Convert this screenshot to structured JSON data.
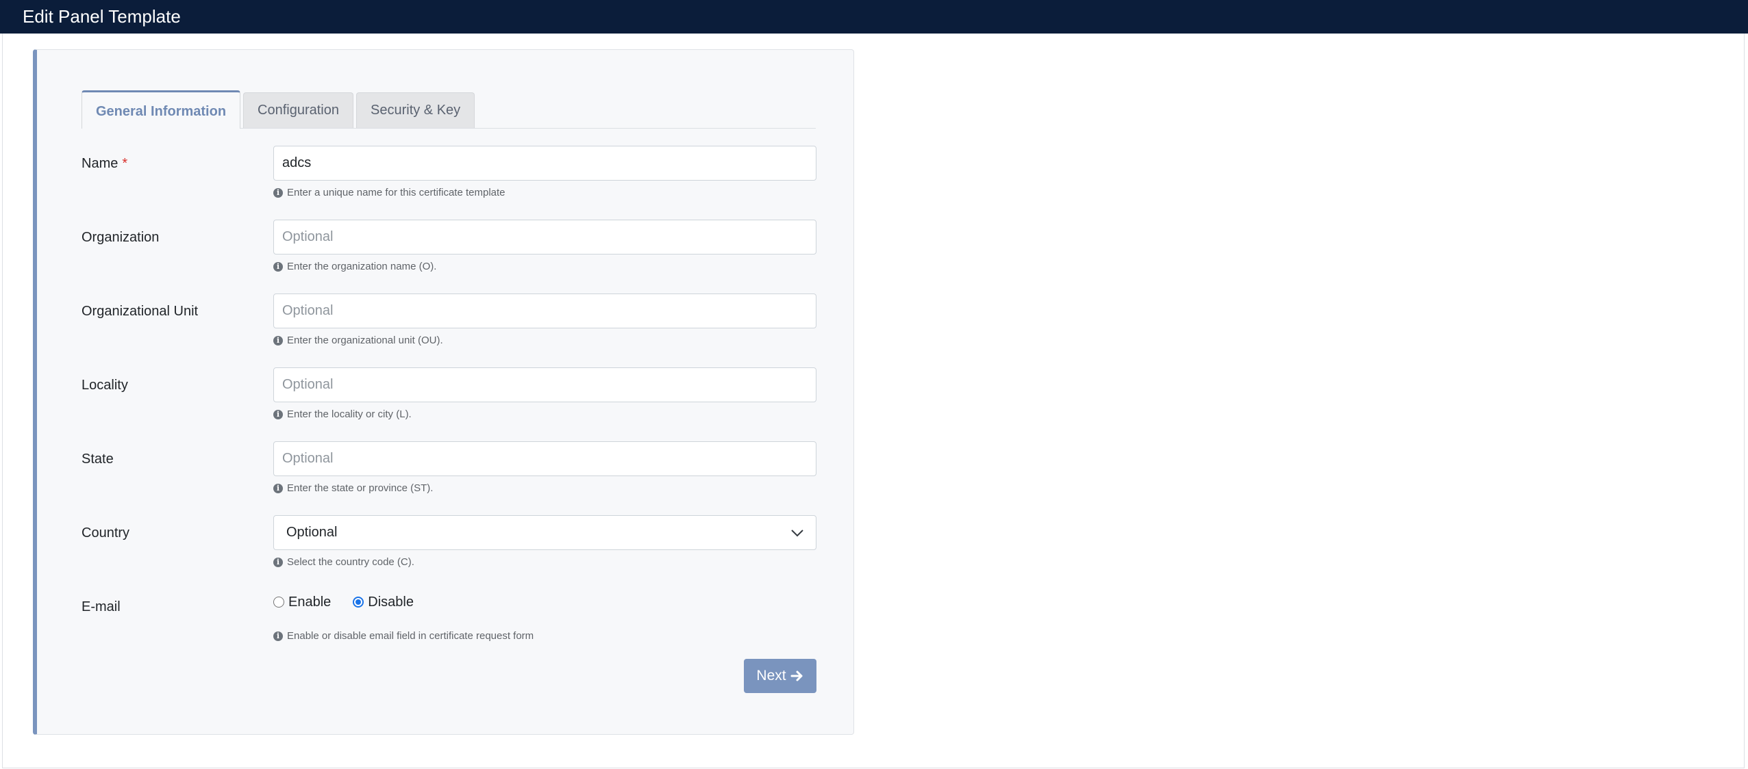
{
  "window": {
    "title": "Edit Panel Template"
  },
  "tabs": [
    {
      "label": "General Information",
      "active": true
    },
    {
      "label": "Configuration",
      "active": false
    },
    {
      "label": "Security & Key",
      "active": false
    }
  ],
  "form": {
    "name": {
      "label": "Name",
      "required_mark": "*",
      "value": "adcs",
      "help": "Enter a unique name for this certificate template"
    },
    "organization": {
      "label": "Organization",
      "placeholder": "Optional",
      "help": "Enter the organization name (O)."
    },
    "org_unit": {
      "label": "Organizational Unit",
      "placeholder": "Optional",
      "help": "Enter the organizational unit (OU)."
    },
    "locality": {
      "label": "Locality",
      "placeholder": "Optional",
      "help": "Enter the locality or city (L)."
    },
    "state": {
      "label": "State",
      "placeholder": "Optional",
      "help": "Enter the state or province (ST)."
    },
    "country": {
      "label": "Country",
      "selected": "Optional",
      "help": "Select the country code (C)."
    },
    "email": {
      "label": "E-mail",
      "options": [
        {
          "label": "Enable",
          "checked": false
        },
        {
          "label": "Disable",
          "checked": true
        }
      ],
      "help": "Enable or disable email field in certificate request form"
    }
  },
  "actions": {
    "next_label": "Next",
    "next_icon": "arrow-right-icon"
  },
  "icons": {
    "info": "i",
    "chevron": "chevron-down-icon"
  },
  "colors": {
    "header_bg": "#0b1d3a",
    "accent": "#7a94be",
    "tab_active": "#6f89b3",
    "required": "#d9302c",
    "radio": "#1a73e8"
  }
}
